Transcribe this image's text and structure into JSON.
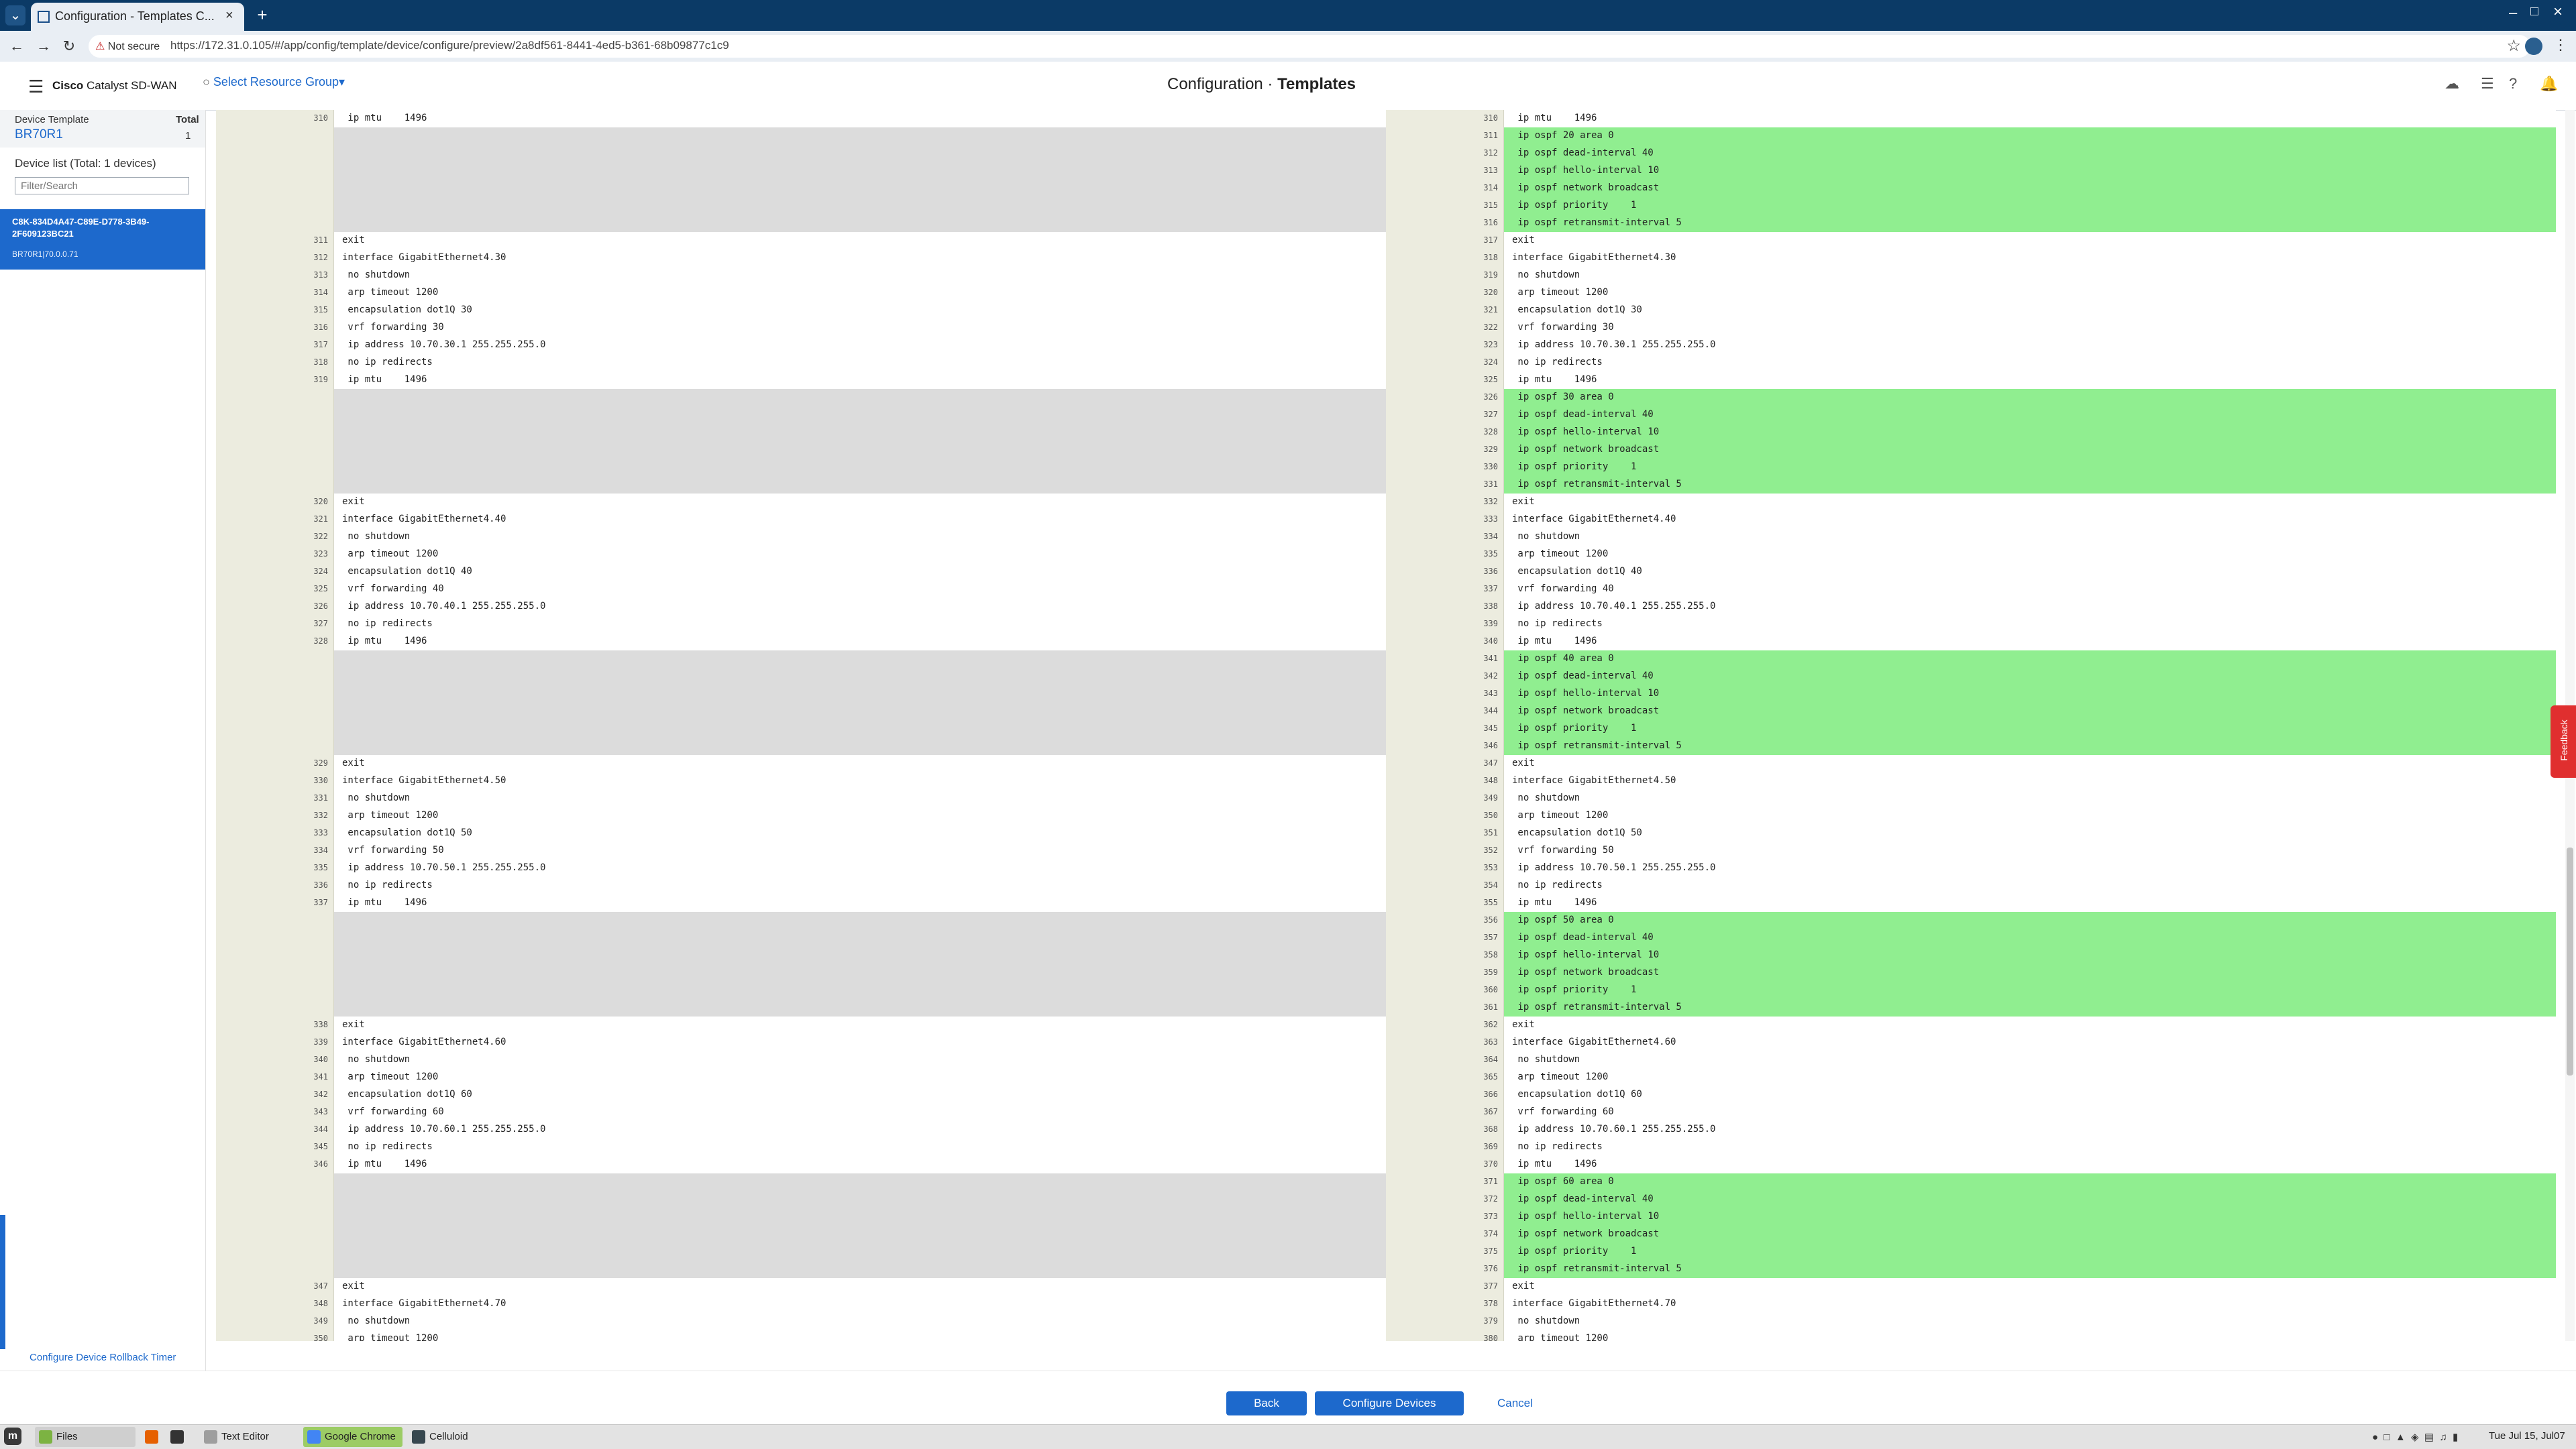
{
  "browser": {
    "tab_title": "Configuration - Templates C...",
    "not_secure": "Not secure",
    "url": "https://172.31.0.105/#/app/config/template/device/configure/preview/2a8df561-8441-4ed5-b361-68b09877c1c9"
  },
  "header": {
    "brand_bold": "Cisco",
    "brand_rest": "Catalyst SD-WAN",
    "resource_group": "Select Resource Group",
    "title_prefix": "Configuration · ",
    "title_main": "Templates"
  },
  "sidebar": {
    "device_template_label": "Device Template",
    "device_template_value": "BR70R1",
    "total_label": "Total",
    "total_value": "1",
    "device_list_title": "Device list (Total: 1 devices)",
    "filter_placeholder": "Filter/Search",
    "device_name": "C8K-834D4A47-C89E-D778-3B49-2F609123BC21",
    "device_sub": "BR70R1|70.0.0.71",
    "rollback_link": "Configure Device Rollback Timer"
  },
  "diff": {
    "left_rows": [
      {
        "n": "310",
        "t": " ip mtu    1496",
        "k": "n"
      },
      {
        "n": "",
        "t": "",
        "k": "b"
      },
      {
        "n": "",
        "t": "",
        "k": "b"
      },
      {
        "n": "",
        "t": "",
        "k": "b"
      },
      {
        "n": "",
        "t": "",
        "k": "b"
      },
      {
        "n": "",
        "t": "",
        "k": "b"
      },
      {
        "n": "",
        "t": "",
        "k": "b"
      },
      {
        "n": "311",
        "t": "exit",
        "k": "n"
      },
      {
        "n": "312",
        "t": "interface GigabitEthernet4.30",
        "k": "n"
      },
      {
        "n": "313",
        "t": " no shutdown",
        "k": "n"
      },
      {
        "n": "314",
        "t": " arp timeout 1200",
        "k": "n"
      },
      {
        "n": "315",
        "t": " encapsulation dot1Q 30",
        "k": "n"
      },
      {
        "n": "316",
        "t": " vrf forwarding 30",
        "k": "n"
      },
      {
        "n": "317",
        "t": " ip address 10.70.30.1 255.255.255.0",
        "k": "n"
      },
      {
        "n": "318",
        "t": " no ip redirects",
        "k": "n"
      },
      {
        "n": "319",
        "t": " ip mtu    1496",
        "k": "n"
      },
      {
        "n": "",
        "t": "",
        "k": "b"
      },
      {
        "n": "",
        "t": "",
        "k": "b"
      },
      {
        "n": "",
        "t": "",
        "k": "b"
      },
      {
        "n": "",
        "t": "",
        "k": "b"
      },
      {
        "n": "",
        "t": "",
        "k": "b"
      },
      {
        "n": "",
        "t": "",
        "k": "b"
      },
      {
        "n": "320",
        "t": "exit",
        "k": "n"
      },
      {
        "n": "321",
        "t": "interface GigabitEthernet4.40",
        "k": "n"
      },
      {
        "n": "322",
        "t": " no shutdown",
        "k": "n"
      },
      {
        "n": "323",
        "t": " arp timeout 1200",
        "k": "n"
      },
      {
        "n": "324",
        "t": " encapsulation dot1Q 40",
        "k": "n"
      },
      {
        "n": "325",
        "t": " vrf forwarding 40",
        "k": "n"
      },
      {
        "n": "326",
        "t": " ip address 10.70.40.1 255.255.255.0",
        "k": "n"
      },
      {
        "n": "327",
        "t": " no ip redirects",
        "k": "n"
      },
      {
        "n": "328",
        "t": " ip mtu    1496",
        "k": "n"
      },
      {
        "n": "",
        "t": "",
        "k": "b"
      },
      {
        "n": "",
        "t": "",
        "k": "b"
      },
      {
        "n": "",
        "t": "",
        "k": "b"
      },
      {
        "n": "",
        "t": "",
        "k": "b"
      },
      {
        "n": "",
        "t": "",
        "k": "b"
      },
      {
        "n": "",
        "t": "",
        "k": "b"
      },
      {
        "n": "329",
        "t": "exit",
        "k": "n"
      },
      {
        "n": "330",
        "t": "interface GigabitEthernet4.50",
        "k": "n"
      },
      {
        "n": "331",
        "t": " no shutdown",
        "k": "n"
      },
      {
        "n": "332",
        "t": " arp timeout 1200",
        "k": "n"
      },
      {
        "n": "333",
        "t": " encapsulation dot1Q 50",
        "k": "n"
      },
      {
        "n": "334",
        "t": " vrf forwarding 50",
        "k": "n"
      },
      {
        "n": "335",
        "t": " ip address 10.70.50.1 255.255.255.0",
        "k": "n"
      },
      {
        "n": "336",
        "t": " no ip redirects",
        "k": "n"
      },
      {
        "n": "337",
        "t": " ip mtu    1496",
        "k": "n"
      },
      {
        "n": "",
        "t": "",
        "k": "b"
      },
      {
        "n": "",
        "t": "",
        "k": "b"
      },
      {
        "n": "",
        "t": "",
        "k": "b"
      },
      {
        "n": "",
        "t": "",
        "k": "b"
      },
      {
        "n": "",
        "t": "",
        "k": "b"
      },
      {
        "n": "",
        "t": "",
        "k": "b"
      },
      {
        "n": "338",
        "t": "exit",
        "k": "n"
      },
      {
        "n": "339",
        "t": "interface GigabitEthernet4.60",
        "k": "n"
      },
      {
        "n": "340",
        "t": " no shutdown",
        "k": "n"
      },
      {
        "n": "341",
        "t": " arp timeout 1200",
        "k": "n"
      },
      {
        "n": "342",
        "t": " encapsulation dot1Q 60",
        "k": "n"
      },
      {
        "n": "343",
        "t": " vrf forwarding 60",
        "k": "n"
      },
      {
        "n": "344",
        "t": " ip address 10.70.60.1 255.255.255.0",
        "k": "n"
      },
      {
        "n": "345",
        "t": " no ip redirects",
        "k": "n"
      },
      {
        "n": "346",
        "t": " ip mtu    1496",
        "k": "n"
      },
      {
        "n": "",
        "t": "",
        "k": "b"
      },
      {
        "n": "",
        "t": "",
        "k": "b"
      },
      {
        "n": "",
        "t": "",
        "k": "b"
      },
      {
        "n": "",
        "t": "",
        "k": "b"
      },
      {
        "n": "",
        "t": "",
        "k": "b"
      },
      {
        "n": "",
        "t": "",
        "k": "b"
      },
      {
        "n": "347",
        "t": "exit",
        "k": "n"
      },
      {
        "n": "348",
        "t": "interface GigabitEthernet4.70",
        "k": "n"
      },
      {
        "n": "349",
        "t": " no shutdown",
        "k": "n"
      },
      {
        "n": "350",
        "t": " arp timeout 1200",
        "k": "n"
      }
    ],
    "right_rows": [
      {
        "n": "310",
        "t": " ip mtu    1496",
        "k": "n"
      },
      {
        "n": "311",
        "t": " ip ospf 20 area 0",
        "k": "a"
      },
      {
        "n": "312",
        "t": " ip ospf dead-interval 40",
        "k": "a"
      },
      {
        "n": "313",
        "t": " ip ospf hello-interval 10",
        "k": "a"
      },
      {
        "n": "314",
        "t": " ip ospf network broadcast",
        "k": "a"
      },
      {
        "n": "315",
        "t": " ip ospf priority    1",
        "k": "a"
      },
      {
        "n": "316",
        "t": " ip ospf retransmit-interval 5",
        "k": "a"
      },
      {
        "n": "317",
        "t": "exit",
        "k": "n"
      },
      {
        "n": "318",
        "t": "interface GigabitEthernet4.30",
        "k": "n"
      },
      {
        "n": "319",
        "t": " no shutdown",
        "k": "n"
      },
      {
        "n": "320",
        "t": " arp timeout 1200",
        "k": "n"
      },
      {
        "n": "321",
        "t": " encapsulation dot1Q 30",
        "k": "n"
      },
      {
        "n": "322",
        "t": " vrf forwarding 30",
        "k": "n"
      },
      {
        "n": "323",
        "t": " ip address 10.70.30.1 255.255.255.0",
        "k": "n"
      },
      {
        "n": "324",
        "t": " no ip redirects",
        "k": "n"
      },
      {
        "n": "325",
        "t": " ip mtu    1496",
        "k": "n"
      },
      {
        "n": "326",
        "t": " ip ospf 30 area 0",
        "k": "a"
      },
      {
        "n": "327",
        "t": " ip ospf dead-interval 40",
        "k": "a"
      },
      {
        "n": "328",
        "t": " ip ospf hello-interval 10",
        "k": "a"
      },
      {
        "n": "329",
        "t": " ip ospf network broadcast",
        "k": "a"
      },
      {
        "n": "330",
        "t": " ip ospf priority    1",
        "k": "a"
      },
      {
        "n": "331",
        "t": " ip ospf retransmit-interval 5",
        "k": "a"
      },
      {
        "n": "332",
        "t": "exit",
        "k": "n"
      },
      {
        "n": "333",
        "t": "interface GigabitEthernet4.40",
        "k": "n"
      },
      {
        "n": "334",
        "t": " no shutdown",
        "k": "n"
      },
      {
        "n": "335",
        "t": " arp timeout 1200",
        "k": "n"
      },
      {
        "n": "336",
        "t": " encapsulation dot1Q 40",
        "k": "n"
      },
      {
        "n": "337",
        "t": " vrf forwarding 40",
        "k": "n"
      },
      {
        "n": "338",
        "t": " ip address 10.70.40.1 255.255.255.0",
        "k": "n"
      },
      {
        "n": "339",
        "t": " no ip redirects",
        "k": "n"
      },
      {
        "n": "340",
        "t": " ip mtu    1496",
        "k": "n"
      },
      {
        "n": "341",
        "t": " ip ospf 40 area 0",
        "k": "a"
      },
      {
        "n": "342",
        "t": " ip ospf dead-interval 40",
        "k": "a"
      },
      {
        "n": "343",
        "t": " ip ospf hello-interval 10",
        "k": "a"
      },
      {
        "n": "344",
        "t": " ip ospf network broadcast",
        "k": "a"
      },
      {
        "n": "345",
        "t": " ip ospf priority    1",
        "k": "a"
      },
      {
        "n": "346",
        "t": " ip ospf retransmit-interval 5",
        "k": "a"
      },
      {
        "n": "347",
        "t": "exit",
        "k": "n"
      },
      {
        "n": "348",
        "t": "interface GigabitEthernet4.50",
        "k": "n"
      },
      {
        "n": "349",
        "t": " no shutdown",
        "k": "n"
      },
      {
        "n": "350",
        "t": " arp timeout 1200",
        "k": "n"
      },
      {
        "n": "351",
        "t": " encapsulation dot1Q 50",
        "k": "n"
      },
      {
        "n": "352",
        "t": " vrf forwarding 50",
        "k": "n"
      },
      {
        "n": "353",
        "t": " ip address 10.70.50.1 255.255.255.0",
        "k": "n"
      },
      {
        "n": "354",
        "t": " no ip redirects",
        "k": "n"
      },
      {
        "n": "355",
        "t": " ip mtu    1496",
        "k": "n"
      },
      {
        "n": "356",
        "t": " ip ospf 50 area 0",
        "k": "a"
      },
      {
        "n": "357",
        "t": " ip ospf dead-interval 40",
        "k": "a"
      },
      {
        "n": "358",
        "t": " ip ospf hello-interval 10",
        "k": "a"
      },
      {
        "n": "359",
        "t": " ip ospf network broadcast",
        "k": "a"
      },
      {
        "n": "360",
        "t": " ip ospf priority    1",
        "k": "a"
      },
      {
        "n": "361",
        "t": " ip ospf retransmit-interval 5",
        "k": "a"
      },
      {
        "n": "362",
        "t": "exit",
        "k": "n"
      },
      {
        "n": "363",
        "t": "interface GigabitEthernet4.60",
        "k": "n"
      },
      {
        "n": "364",
        "t": " no shutdown",
        "k": "n"
      },
      {
        "n": "365",
        "t": " arp timeout 1200",
        "k": "n"
      },
      {
        "n": "366",
        "t": " encapsulation dot1Q 60",
        "k": "n"
      },
      {
        "n": "367",
        "t": " vrf forwarding 60",
        "k": "n"
      },
      {
        "n": "368",
        "t": " ip address 10.70.60.1 255.255.255.0",
        "k": "n"
      },
      {
        "n": "369",
        "t": " no ip redirects",
        "k": "n"
      },
      {
        "n": "370",
        "t": " ip mtu    1496",
        "k": "n"
      },
      {
        "n": "371",
        "t": " ip ospf 60 area 0",
        "k": "a"
      },
      {
        "n": "372",
        "t": " ip ospf dead-interval 40",
        "k": "a"
      },
      {
        "n": "373",
        "t": " ip ospf hello-interval 10",
        "k": "a"
      },
      {
        "n": "374",
        "t": " ip ospf network broadcast",
        "k": "a"
      },
      {
        "n": "375",
        "t": " ip ospf priority    1",
        "k": "a"
      },
      {
        "n": "376",
        "t": " ip ospf retransmit-interval 5",
        "k": "a"
      },
      {
        "n": "377",
        "t": "exit",
        "k": "n"
      },
      {
        "n": "378",
        "t": "interface GigabitEthernet4.70",
        "k": "n"
      },
      {
        "n": "379",
        "t": " no shutdown",
        "k": "n"
      },
      {
        "n": "380",
        "t": " arp timeout 1200",
        "k": "n"
      }
    ]
  },
  "feedback": "Feedback",
  "footer": {
    "back": "Back",
    "configure": "Configure Devices",
    "cancel": "Cancel"
  },
  "taskbar": {
    "files": "Files",
    "text_editor": "Text Editor",
    "chrome": "Google Chrome",
    "celluloid": "Celluloid",
    "clock": "Tue Jul 15, Jul07"
  },
  "colors": {
    "accent": "#1d69cc",
    "added_line": "#90ee90",
    "blank_line": "#dcdcdc",
    "gutter": "#ececdf",
    "tab_strip": "#0b3a66"
  }
}
